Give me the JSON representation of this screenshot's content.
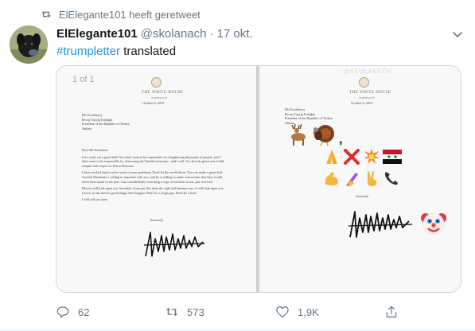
{
  "retweet_context": {
    "text": "ElElegante101 heeft geretweet"
  },
  "author": {
    "display_name": "ElElegante101",
    "handle": "@skolanach",
    "separator": "·",
    "time": "17 okt."
  },
  "tweet": {
    "hashtag": "#trumpletter",
    "text": " translated"
  },
  "media": {
    "page_counter": "1 of 1",
    "left_page": {
      "title": "THE WHITE HOUSE",
      "city": "WASHINGTON",
      "date": "October 9, 2019",
      "recipient": [
        "His Excellency",
        "Recep Tayyip Erdoğan",
        "President of the Republic of Turkey",
        "Ankara"
      ],
      "salutation": "Dear Mr. President:",
      "paragraphs": [
        "Let's work out a good deal! You don't want to be responsible for slaughtering thousands of people, and I don't want to be responsible for destroying the Turkish economy—and I will. I've already given you a little sample with respect to Pastor Brunson.",
        "I have worked hard to solve some of your problems. Don't let the world down. You can make a great deal. General Mazloum is willing to negotiate with you, and he is willing to make concessions that they would never have made in the past. I am confidentially enclosing a copy of his letter to me, just received.",
        "History will look upon you favorably if you get this done the right and humane way. It will look upon you forever as the devil if good things don't happen. Don't be a tough guy. Don't be a fool!",
        "I will call you later."
      ],
      "closing": "Sincerely,"
    },
    "right_page": {
      "watermark": "@SKOLANACH",
      "title": "THE WHITE HOUSE",
      "city": "WASHINGTON",
      "date": "October 9, 2019",
      "recipient": [
        "His Excellency",
        "Recep Tayyip Erdoğan",
        "President of the Republic of Turkey",
        "Ankara"
      ],
      "closing": "Sincerely,"
    }
  },
  "actions": {
    "replies": "62",
    "retweets": "573",
    "likes": "1,9K"
  },
  "colors": {
    "accent": "#1b95e0",
    "muted": "#657786",
    "retweet_green": "#17bf63"
  }
}
